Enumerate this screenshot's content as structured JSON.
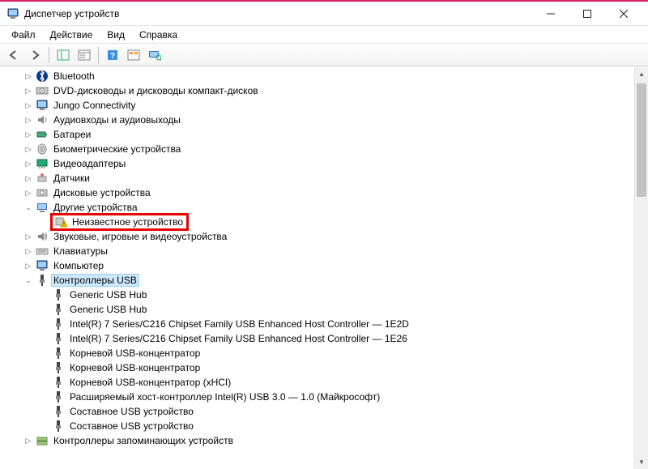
{
  "window": {
    "title": "Диспетчер устройств"
  },
  "menu": {
    "file": "Файл",
    "action": "Действие",
    "view": "Вид",
    "help": "Справка"
  },
  "tree": {
    "bluetooth": "Bluetooth",
    "dvd": "DVD-дисководы и дисководы компакт-дисков",
    "jungo": "Jungo Connectivity",
    "audio": "Аудиовходы и аудиовыходы",
    "battery": "Батареи",
    "biometric": "Биометрические устройства",
    "video": "Видеоадаптеры",
    "sensors": "Датчики",
    "disk": "Дисковые устройства",
    "other": "Другие устройства",
    "unknown": "Неизвестное устройство",
    "sound": "Звуковые, игровые и видеоустройства",
    "keyboard": "Клавиатуры",
    "computer": "Компьютер",
    "usbctrl": "Контроллеры USB",
    "usb": {
      "hub1": "Generic USB Hub",
      "hub2": "Generic USB Hub",
      "intel1": "Intel(R) 7 Series/C216 Chipset Family USB Enhanced Host Controller — 1E2D",
      "intel2": "Intel(R) 7 Series/C216 Chipset Family USB Enhanced Host Controller — 1E26",
      "root1": "Корневой USB-концентратор",
      "root2": "Корневой USB-концентратор",
      "root3": "Корневой USB-концентратор (xHCI)",
      "xhci": "Расширяемый хост-контроллер Intel(R) USB 3.0 — 1.0 (Майкрософт)",
      "comp1": "Составное USB устройство",
      "comp2": "Составное USB устройство"
    },
    "storage": "Контроллеры запоминающих устройств"
  }
}
